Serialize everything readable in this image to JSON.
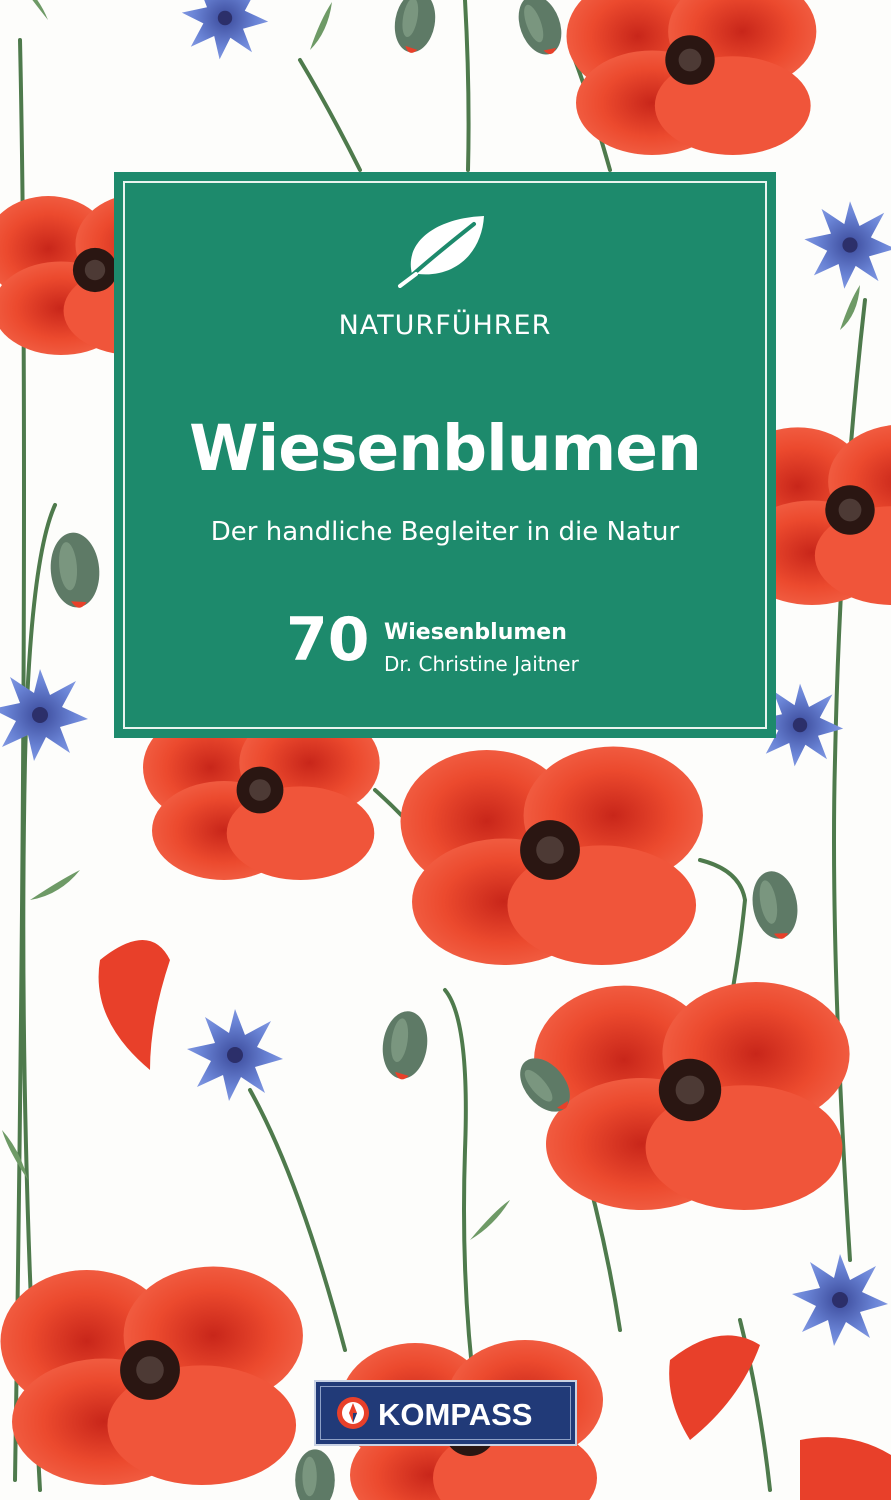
{
  "cover": {
    "series": "NATURFÜHRER",
    "title": "Wiesenblumen",
    "subtitle": "Der handliche Begleiter in die Natur",
    "count": "70",
    "count_label": "Wiesenblumen",
    "author": "Dr. Christine Jaitner",
    "publisher": "KOMPASS"
  },
  "icons": {
    "series_icon": "leaf-icon",
    "publisher_icon": "compass-icon"
  },
  "colors": {
    "panel": "#1d8a6c",
    "publisher_badge": "#213a78",
    "poppy": "#e8402a",
    "cornflower": "#5b73c9"
  }
}
